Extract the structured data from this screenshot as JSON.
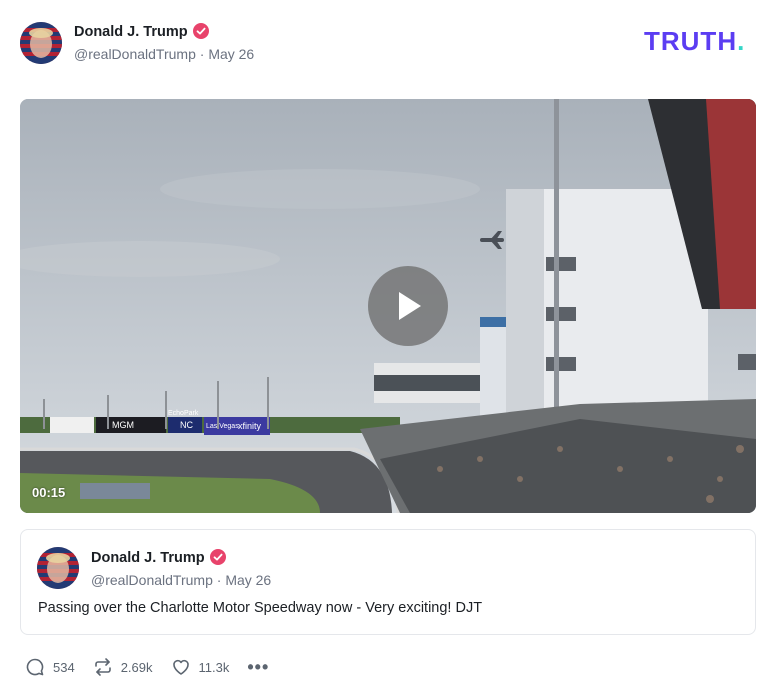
{
  "post": {
    "author_name": "Donald J. Trump",
    "handle": "@realDonaldTrump",
    "separator": "·",
    "date": "May 26"
  },
  "brand": {
    "logo_text": "TRUTH",
    "logo_dot": ".",
    "logo_color": "#5b3df2",
    "dot_color": "#34d6c8"
  },
  "video": {
    "duration": "00:15",
    "play_icon": "play-icon",
    "billboards": [
      "MGM",
      "NC",
      "Las Vegas",
      "xfinity",
      "EchoPark"
    ]
  },
  "quoted_post": {
    "author_name": "Donald J. Trump",
    "handle": "@realDonaldTrump",
    "separator": "·",
    "date": "May 26",
    "text": "Passing over the Charlotte Motor Speedway now - Very exciting! DJT"
  },
  "actions": {
    "replies": "534",
    "retruths": "2.69k",
    "likes": "11.3k",
    "more": "•••"
  },
  "colors": {
    "verified": "#e8436b",
    "muted": "#6b7280"
  }
}
